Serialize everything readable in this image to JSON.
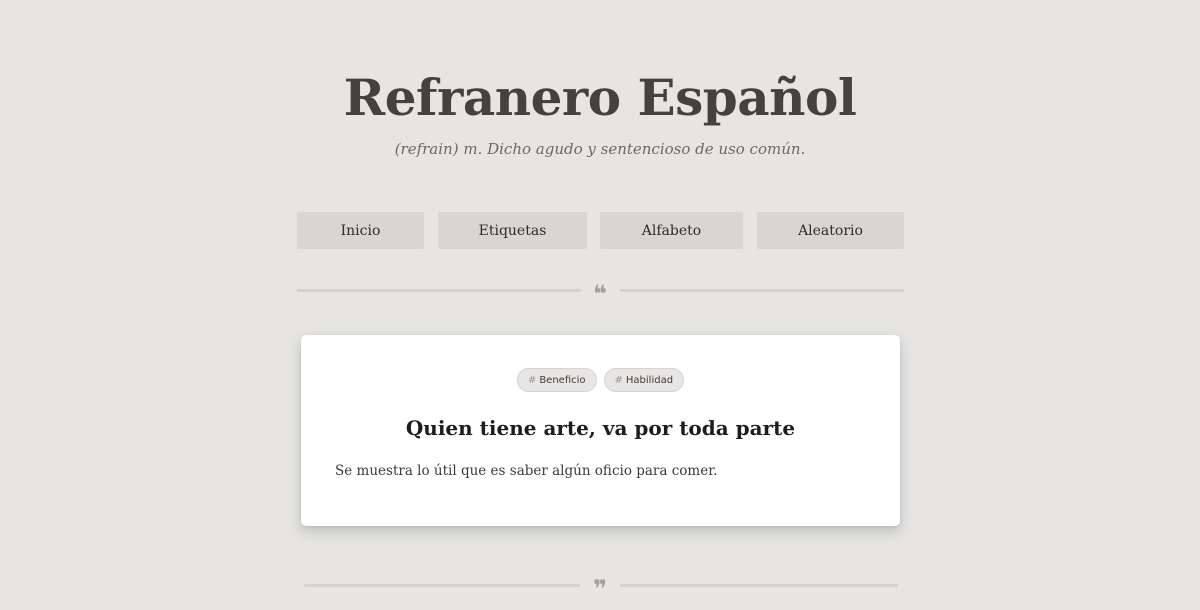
{
  "header": {
    "title": "Refranero Español",
    "subtitle": "(refrain) m. Dicho agudo y sentencioso de uso común."
  },
  "nav": {
    "items": [
      {
        "label": "Inicio"
      },
      {
        "label": "Etiquetas"
      },
      {
        "label": "Alfabeto"
      },
      {
        "label": "Aleatorio"
      }
    ]
  },
  "dividers": {
    "top_glyph": "❝",
    "bottom_glyph": "❞"
  },
  "proverb": {
    "tags": [
      {
        "hash": "#",
        "label": "Beneficio"
      },
      {
        "hash": "#",
        "label": "Habilidad"
      }
    ],
    "title": "Quien tiene arte, va por toda parte",
    "meaning": "Se muestra lo útil que es saber algún oficio para comer."
  }
}
